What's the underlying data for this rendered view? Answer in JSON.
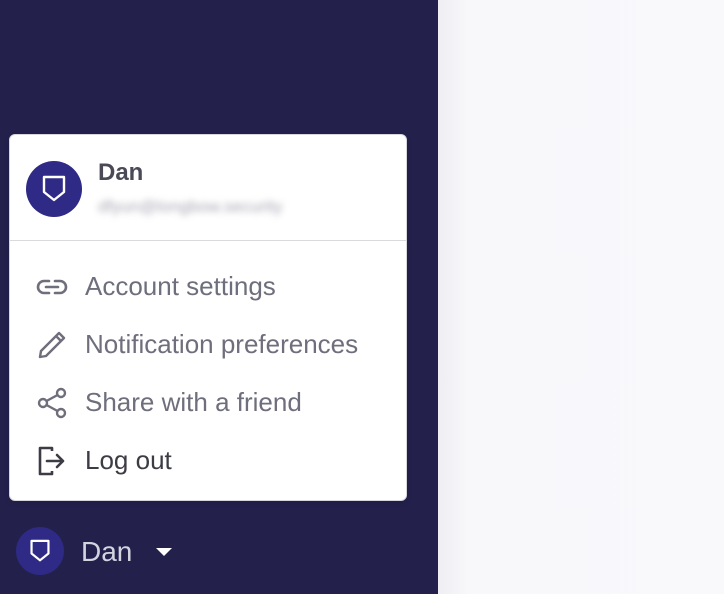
{
  "user": {
    "name": "Dan",
    "email": "dfyun@longbow.security"
  },
  "menu": {
    "items": [
      {
        "label": "Account settings",
        "icon": "link-icon"
      },
      {
        "label": "Notification preferences",
        "icon": "pencil-icon"
      },
      {
        "label": "Share with a friend",
        "icon": "share-icon"
      },
      {
        "label": "Log out",
        "icon": "logout-icon"
      }
    ]
  },
  "sidebar_trigger": {
    "name": "Dan",
    "icon": "chevron-down-icon"
  },
  "colors": {
    "sidebar_bg": "#23214c",
    "avatar_bg": "#2e2a85",
    "menu_text": "#6e6e7c",
    "main_bg": "#f8f8fb"
  }
}
